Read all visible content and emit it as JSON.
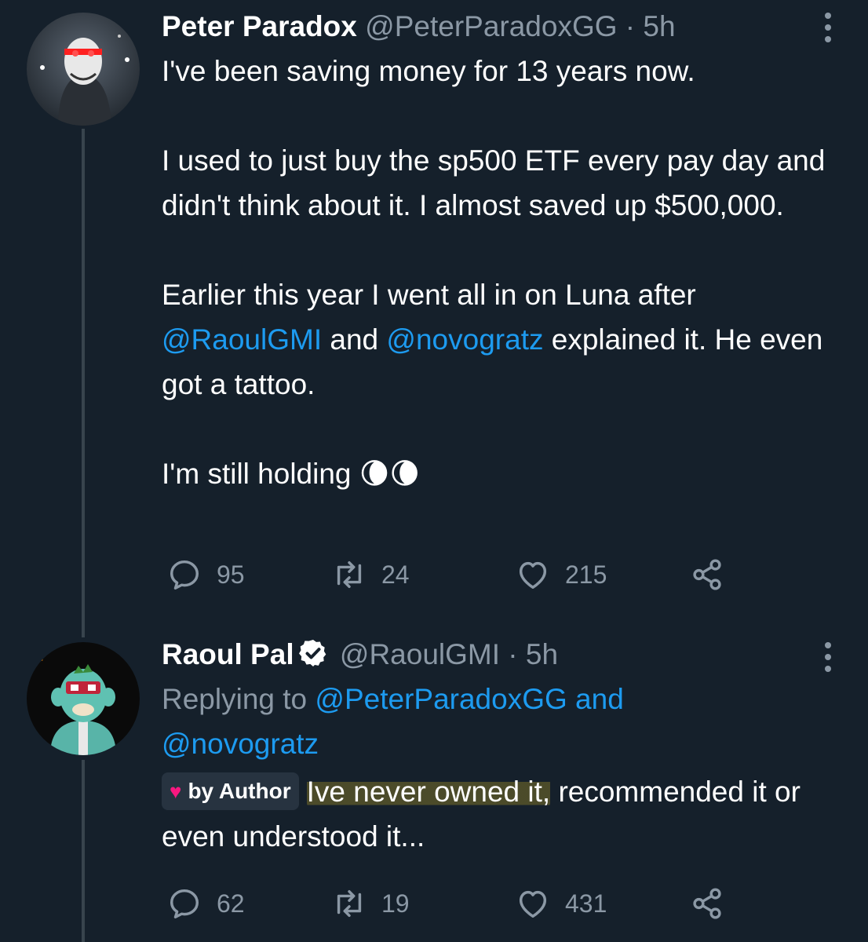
{
  "tweets": [
    {
      "name": "Peter Paradox",
      "handle": "@PeterParadoxGG",
      "sep": " · ",
      "time": "5h",
      "line1": "I've been saving money for 13 years now.",
      "para2": "I used to just buy the sp500 ETF every pay day and didn't think about it. I almost saved up $500,000.",
      "para3_start": "Earlier this year I went all in on Luna after ",
      "mention1": "@RaoulGMI",
      "para3_and": " and ",
      "mention2": "@novogratz",
      "para3_end": " explained it. He even got a tattoo.",
      "para4": "I'm still holding",
      "emoji": "🌘🌘",
      "replies": "95",
      "retweets": "24",
      "likes": "215"
    },
    {
      "name": "Raoul Pal",
      "handle": "@RaoulGMI",
      "sep": " · ",
      "time": "5h",
      "replying_prefix": "Replying to ",
      "replying_user1": "@PeterParadoxGG",
      "replying_and": " and",
      "replying_user2": "@novogratz",
      "badge_label": "by Author",
      "text_highlight": "Ive never owned it,",
      "text_rest": " recommended it or even understood it...",
      "replies": "62",
      "retweets": "19",
      "likes": "431"
    }
  ],
  "colors": {
    "background": "#15202b",
    "muted": "#8b98a5",
    "link": "#1d9bf0",
    "thread_line": "#38444d",
    "verified": "#ffffff",
    "heart": "#f91880"
  },
  "icons": [
    "reply-icon",
    "retweet-icon",
    "like-icon",
    "share-icon",
    "more-icon",
    "verified-icon",
    "heart-icon"
  ]
}
